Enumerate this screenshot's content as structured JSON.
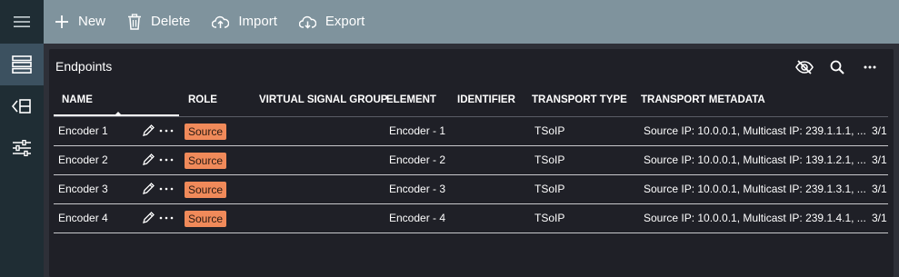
{
  "toolbar": {
    "new_label": "New",
    "delete_label": "Delete",
    "import_label": "Import",
    "export_label": "Export"
  },
  "sidebar": {
    "menu_icon": "hamburger-icon",
    "items": [
      {
        "icon": "list-view-icon",
        "active": true
      },
      {
        "icon": "back-list-icon",
        "active": false
      },
      {
        "icon": "settings-list-icon",
        "active": false
      }
    ]
  },
  "panel": {
    "title": "Endpoints",
    "icons": [
      "eye-off-icon",
      "search-icon",
      "more-icon"
    ]
  },
  "table": {
    "columns": [
      "NAME",
      "ROLE",
      "VIRTUAL SIGNAL GROUP",
      "ELEMENT",
      "IDENTIFIER",
      "TRANSPORT TYPE",
      "TRANSPORT METADATA"
    ],
    "rows": [
      {
        "name": "Encoder 1",
        "role": "Source",
        "element": "Encoder - 1",
        "transport_type": "TSoIP",
        "metadata": "Source IP: 10.0.0.1, Multicast IP: 239.1.1.1, ...",
        "extra": "3/1"
      },
      {
        "name": "Encoder 2",
        "role": "Source",
        "element": "Encoder - 2",
        "transport_type": "TSoIP",
        "metadata": "Source IP: 10.0.0.1, Multicast IP: 139.1.2.1, ...",
        "extra": "3/1"
      },
      {
        "name": "Encoder 3",
        "role": "Source",
        "element": "Encoder - 3",
        "transport_type": "TSoIP",
        "metadata": "Source IP: 10.0.0.1, Multicast IP: 239.1.3.1, ...",
        "extra": "3/1"
      },
      {
        "name": "Encoder 4",
        "role": "Source",
        "element": "Encoder - 4",
        "transport_type": "TSoIP",
        "metadata": "Source IP: 10.0.0.1, Multicast IP: 239.1.4.1, ...",
        "extra": "3/1"
      }
    ]
  },
  "colors": {
    "toolbar_bg": "#7f939d",
    "sidebar_bg": "#1f2d34",
    "panel_bg": "#1f2027",
    "badge_bg": "#f08a5a"
  }
}
